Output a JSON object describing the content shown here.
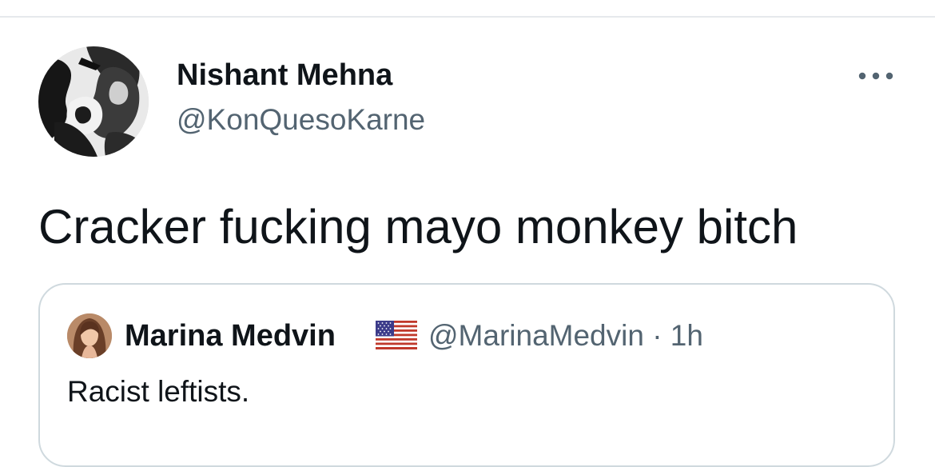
{
  "tweet": {
    "author": {
      "name": "Nishant Mehna",
      "handle": "@KonQuesoKarne"
    },
    "more_icon": "more-horizontal-icon",
    "text": "Cracker fucking mayo monkey bitch"
  },
  "quote": {
    "author": {
      "name": "Marina Medvin",
      "flag_icon": "us-flag-icon",
      "handle_time": "@MarinaMedvin · 1h"
    },
    "text": "Racist leftists."
  },
  "colors": {
    "text": "#0f1419",
    "secondary_text": "#536471",
    "border": "#cfd9de",
    "divider": "#e6e9ec",
    "background": "#ffffff"
  }
}
